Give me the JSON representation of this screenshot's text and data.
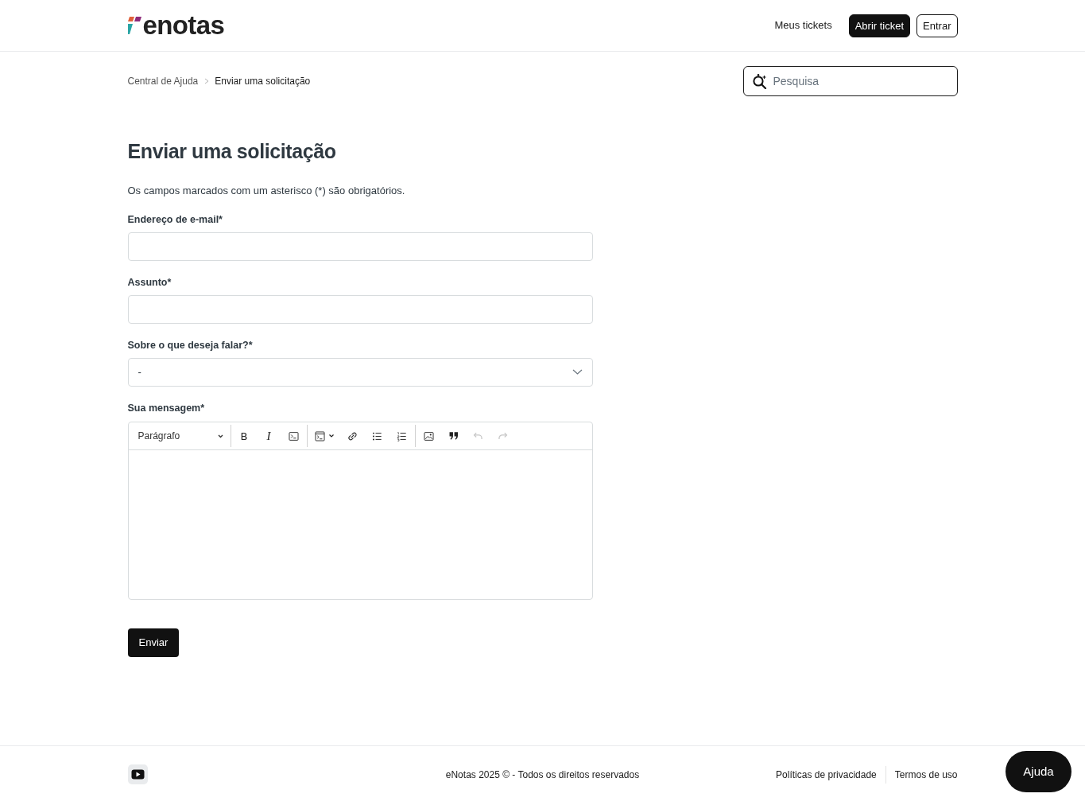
{
  "header": {
    "logo": {
      "text": "enotas"
    },
    "nav": [
      {
        "label": "Meus tickets",
        "kind": "link"
      },
      {
        "label": "Abrir ticket",
        "kind": "filled"
      },
      {
        "label": "Entrar",
        "kind": "outline"
      }
    ]
  },
  "breadcrumb": [
    "Central de Ajuda",
    "Enviar uma solicitação"
  ],
  "search": {
    "placeholder": "Pesquisa"
  },
  "form": {
    "title": "Enviar uma solicitação",
    "note": "Os campos marcados com um asterisco (*) são obrigatórios.",
    "fields": [
      {
        "kind": "text",
        "label": "Endereço de e-mail*"
      },
      {
        "kind": "text",
        "label": "Assunto*"
      },
      {
        "kind": "select",
        "label": "Sobre o que deseja falar?*",
        "value": "-"
      },
      {
        "kind": "editor",
        "label": "Sua mensagem*",
        "block_style": "Parágrafo",
        "toolbar": [
          [
            {
              "kind": "bold",
              "label": "B",
              "disabled": false
            },
            {
              "kind": "italic",
              "label": "I",
              "disabled": false
            },
            {
              "kind": "code",
              "disabled": false
            }
          ],
          [
            {
              "kind": "code-block",
              "disabled": false
            },
            {
              "kind": "link",
              "disabled": false
            },
            {
              "kind": "bulleted-list",
              "disabled": false
            },
            {
              "kind": "numbered-list",
              "disabled": false
            }
          ],
          [
            {
              "kind": "image",
              "disabled": false
            },
            {
              "kind": "quote",
              "disabled": false
            },
            {
              "kind": "undo",
              "disabled": true
            },
            {
              "kind": "redo",
              "disabled": true
            }
          ]
        ]
      }
    ],
    "submit": "Enviar"
  },
  "footer": {
    "copyright": "eNotas 2025 © - Todos os direitos reservados",
    "links": [
      "Políticas de privacidade",
      "Termos de uso"
    ]
  },
  "help_button": "Ajuda"
}
